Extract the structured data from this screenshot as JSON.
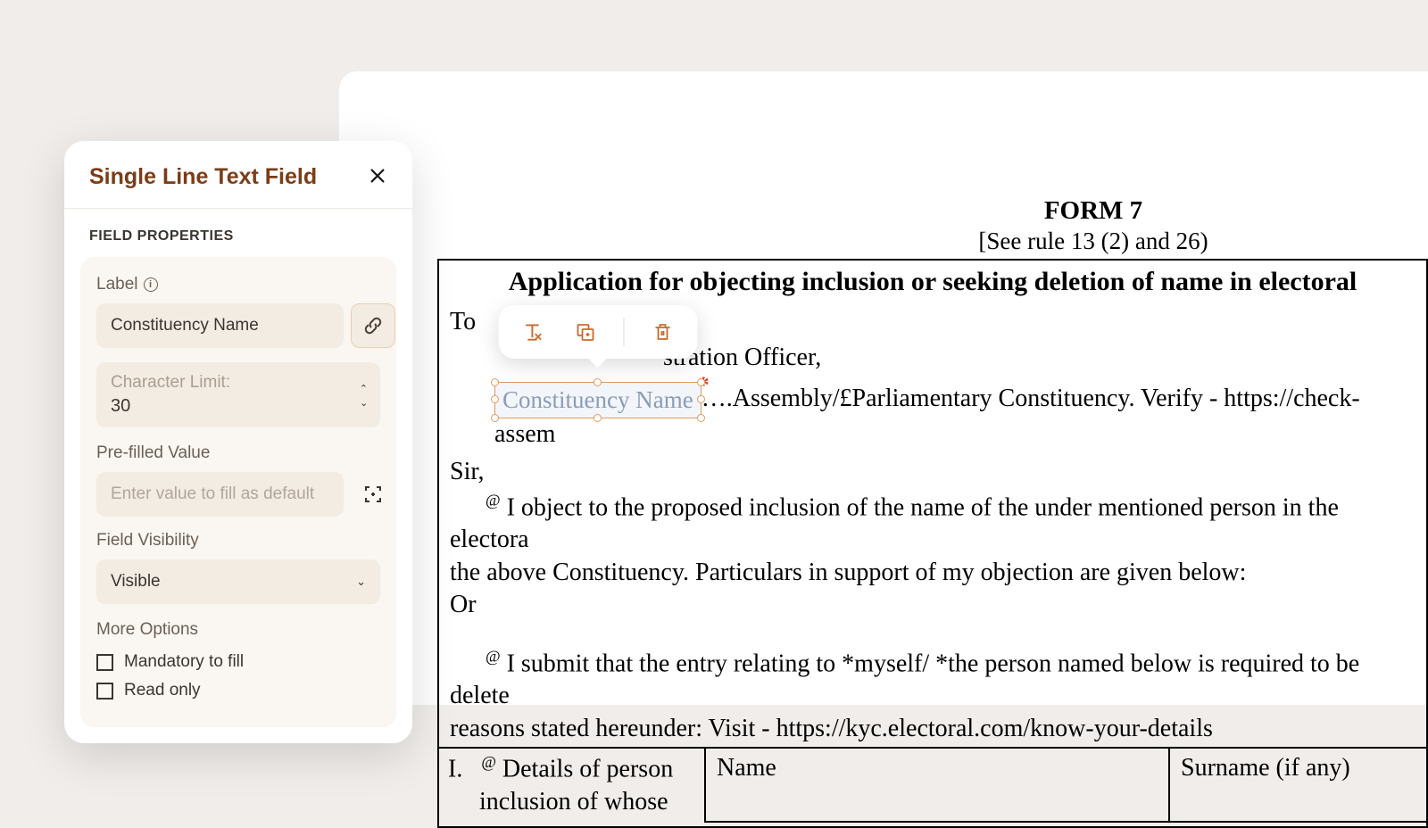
{
  "panel": {
    "title": "Single Line Text Field",
    "section_title": "FIELD PROPERTIES",
    "label_label": "Label",
    "label_value": "Constituency Name",
    "char_limit_label": "Character Limit:",
    "char_limit_value": "30",
    "prefill_label": "Pre-filled Value",
    "prefill_placeholder": "Enter value to fill as default",
    "visibility_label": "Field Visibility",
    "visibility_value": "Visible",
    "more_options_label": "More Options",
    "opt_mandatory": "Mandatory to fill",
    "opt_readonly": "Read only"
  },
  "document": {
    "form_title": "FORM 7",
    "form_subtitle": "[See rule 13 (2) and 26)",
    "app_heading": "Application for objecting inclusion or seeking deletion of name in electoral",
    "to": "To",
    "officer_tail": "stration Officer,",
    "line1_field": "Constituency Name",
    "line1_after": "….Assembly/£Parliamentary Constituency. Verify - https://check-assem",
    "sir": "Sir,",
    "para1": "I object to the proposed inclusion of the name of the under mentioned person in the electora",
    "para1b": "the above Constituency. Particulars in support of my objection are given below:",
    "or": "Or",
    "para2": "I submit that the entry relating to *myself/ *the person named below is required to be delete",
    "para2b": "reasons stated hereunder: Visit - https://kyc.electoral.com/know-your-details",
    "row_i": "I.",
    "row_i_text1": "Details of person",
    "row_i_text2": "inclusion of whose",
    "col_name": "Name",
    "col_surname": "Surname (if any)"
  }
}
